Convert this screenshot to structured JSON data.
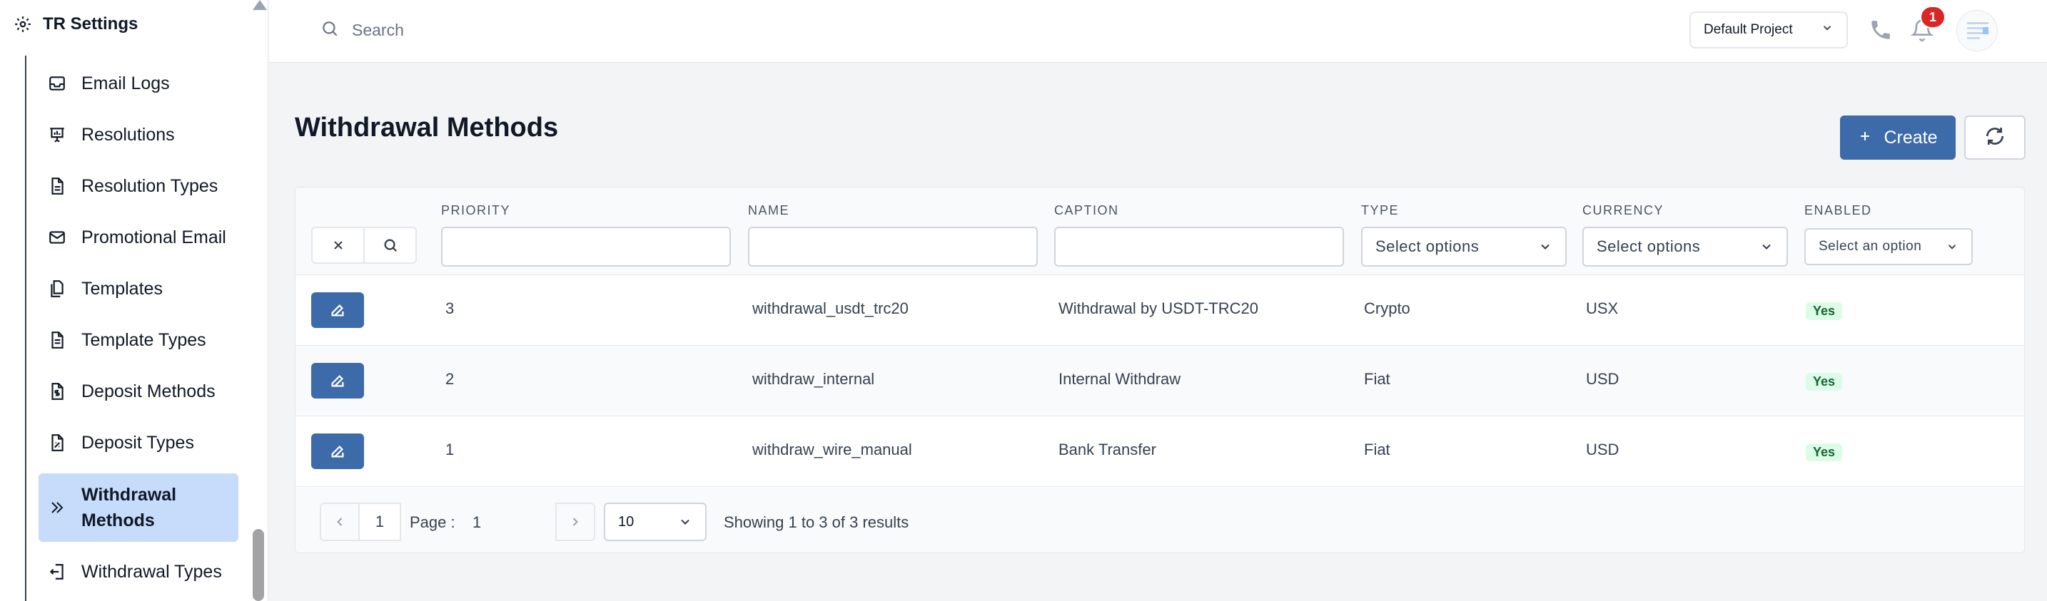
{
  "sidebar": {
    "title": "TR Settings",
    "items": [
      {
        "label": "Email Logs",
        "icon": "inbox-icon"
      },
      {
        "label": "Resolutions",
        "icon": "presentation-chart-icon"
      },
      {
        "label": "Resolution Types",
        "icon": "document-icon"
      },
      {
        "label": "Promotional Email",
        "icon": "envelope-icon"
      },
      {
        "label": "Templates",
        "icon": "documents-icon"
      },
      {
        "label": "Template Types",
        "icon": "document-text-icon"
      },
      {
        "label": "Deposit Methods",
        "icon": "document-dollar-icon"
      },
      {
        "label": "Deposit Types",
        "icon": "document-chart-icon"
      },
      {
        "label": "Withdrawal Methods",
        "icon": "chevron-double-right-icon"
      },
      {
        "label": "Withdrawal Types",
        "icon": "arrow-left-on-rectangle-icon"
      }
    ],
    "active_index": 8
  },
  "topbar": {
    "search_placeholder": "Search",
    "project": "Default Project",
    "notification_count": "1"
  },
  "main": {
    "title": "Withdrawal Methods",
    "create_label": "Create"
  },
  "table": {
    "columns": [
      "PRIORITY",
      "NAME",
      "CAPTION",
      "TYPE",
      "CURRENCY",
      "ENABLED"
    ],
    "filters": {
      "type_placeholder": "Select options",
      "currency_placeholder": "Select options",
      "enabled_placeholder": "Select an option"
    },
    "rows": [
      {
        "priority": "3",
        "name": "withdrawal_usdt_trc20",
        "caption": "Withdrawal by USDT-TRC20",
        "type": "Crypto",
        "currency": "USX",
        "enabled": "Yes"
      },
      {
        "priority": "2",
        "name": "withdraw_internal",
        "caption": "Internal Withdraw",
        "type": "Fiat",
        "currency": "USD",
        "enabled": "Yes"
      },
      {
        "priority": "1",
        "name": "withdraw_wire_manual",
        "caption": "Bank Transfer",
        "type": "Fiat",
        "currency": "USD",
        "enabled": "Yes"
      }
    ]
  },
  "pagination": {
    "current_page": "1",
    "page_label": "Page :",
    "page_value": "1",
    "page_size": "10",
    "info": "Showing 1 to 3 of 3 results"
  },
  "colors": {
    "primary": "#3d6aa8",
    "active_bg": "#c7dcfb",
    "badge": "#dc2626",
    "success_bg": "#dcfce7",
    "success_text": "#166534"
  }
}
